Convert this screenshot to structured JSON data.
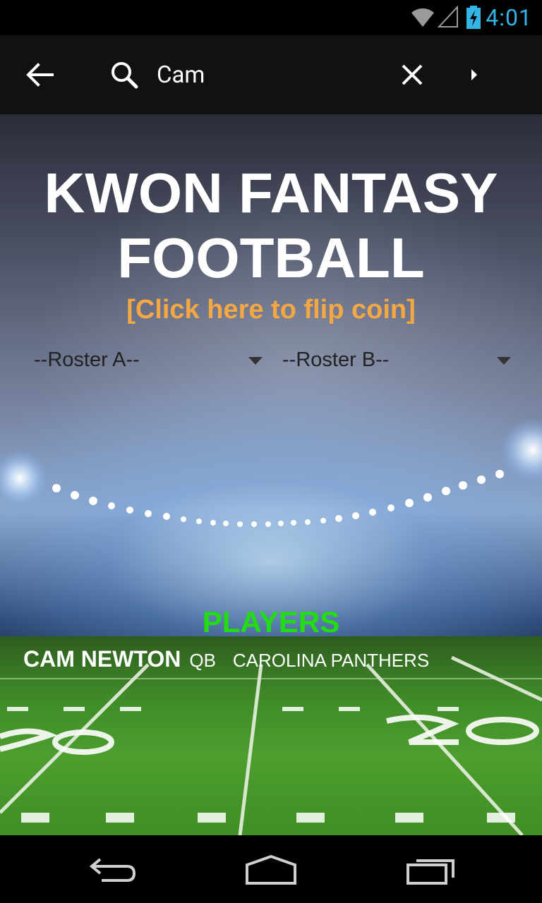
{
  "status_bar": {
    "time": "4:01",
    "icons": [
      "wifi-icon",
      "signal-icon",
      "battery-charging-icon"
    ],
    "accent_color": "#33b5e5"
  },
  "action_bar": {
    "search_value": "Cam",
    "icons": [
      "back-arrow-icon",
      "search-icon",
      "close-icon",
      "overflow-arrow-icon"
    ]
  },
  "main": {
    "title_line1": "KWON FANTASY",
    "title_line2": "FOOTBALL",
    "flip_coin_link": "[Click here to flip coin]",
    "link_color": "#f5a742",
    "roster_a": "--Roster A--",
    "roster_b": "--Roster B--",
    "players_heading": "PLAYERS",
    "players_heading_color": "#22dd11",
    "players": [
      {
        "name": "CAM NEWTON",
        "position": "QB",
        "team": "CAROLINA PANTHERS"
      }
    ]
  },
  "nav_bar": {
    "icons": [
      "back-icon",
      "home-icon",
      "recents-icon"
    ]
  }
}
